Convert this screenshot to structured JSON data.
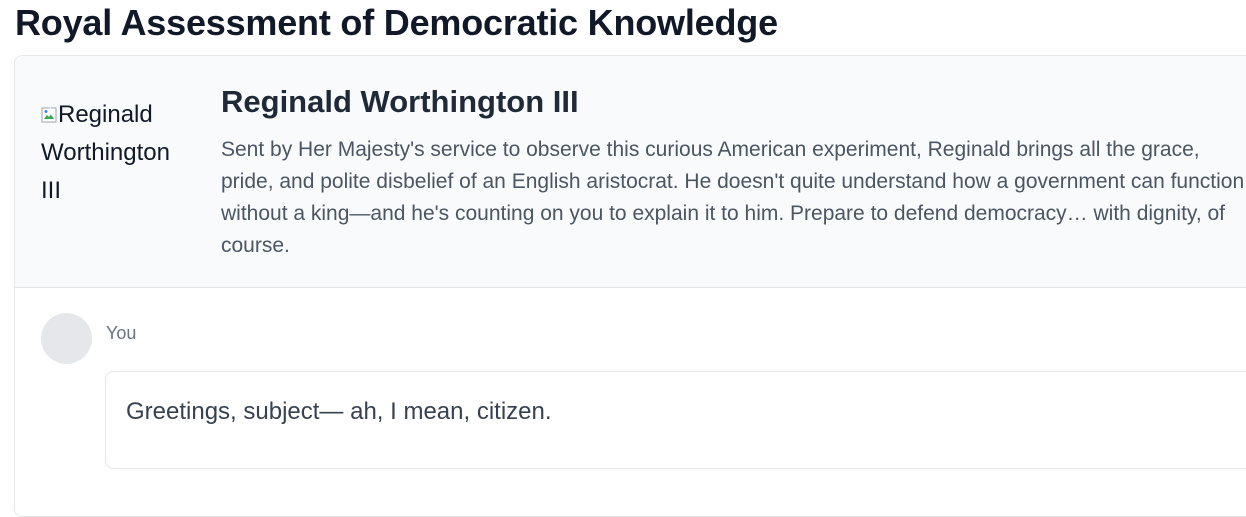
{
  "page": {
    "title": "Royal Assessment of Democratic Knowledge"
  },
  "character": {
    "avatar_alt": "Reginald Worthington III",
    "name": "Reginald Worthington III",
    "description": "Sent by Her Majesty's service to observe this curious American experiment, Reginald brings all the grace, pride, and polite disbelief of an English aristocrat. He doesn't quite understand how a government can function without a king—and he's counting on you to explain it to him. Prepare to defend democracy… with dignity, of course."
  },
  "messages": [
    {
      "sender": "You",
      "text": "Greetings, subject— ah, I mean, citizen."
    }
  ],
  "icons": {
    "broken_image": "broken-image-icon"
  },
  "colors": {
    "header_background": "#f9fafb",
    "border": "#e5e7eb",
    "title_text": "#111827",
    "description_text": "#4b5563",
    "sender_text": "#6b7280",
    "avatar_placeholder": "#e5e7eb"
  }
}
